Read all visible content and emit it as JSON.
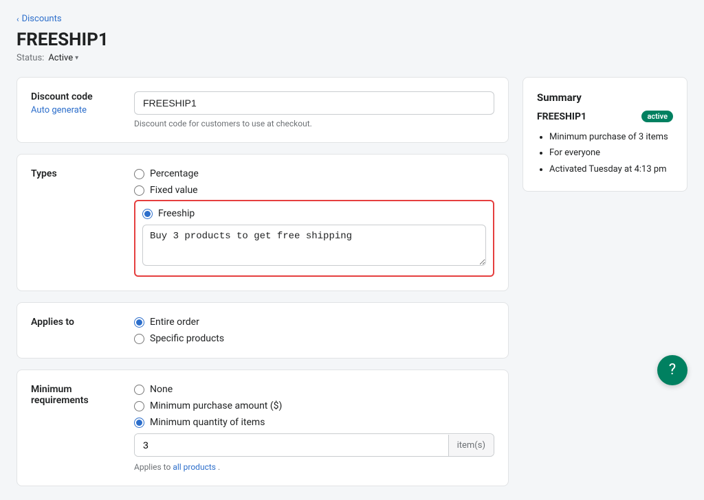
{
  "breadcrumb": {
    "label": "Discounts",
    "chevron": "‹"
  },
  "page": {
    "title": "FREESHIP1",
    "status_label": "Status:",
    "status_value": "Active",
    "status_chevron": "▾"
  },
  "discount_code_section": {
    "label": "Discount code",
    "auto_generate": "Auto generate",
    "input_value": "FREESHIP1",
    "hint": "Discount code for customers to use at checkout."
  },
  "types_section": {
    "label": "Types",
    "options": [
      {
        "id": "percentage",
        "label": "Percentage",
        "checked": false
      },
      {
        "id": "fixed",
        "label": "Fixed value",
        "checked": false
      },
      {
        "id": "freeship",
        "label": "Freeship",
        "checked": true
      }
    ],
    "freeship_textarea": "Buy 3 products to get free shipping"
  },
  "applies_to_section": {
    "label": "Applies to",
    "options": [
      {
        "id": "entire",
        "label": "Entire order",
        "checked": true
      },
      {
        "id": "specific",
        "label": "Specific products",
        "checked": false
      }
    ]
  },
  "min_requirements_section": {
    "label": "Minimum",
    "label2": "requirements",
    "options": [
      {
        "id": "none",
        "label": "None",
        "checked": false
      },
      {
        "id": "amount",
        "label": "Minimum purchase amount ($)",
        "checked": false
      },
      {
        "id": "quantity",
        "label": "Minimum quantity of items",
        "checked": true
      }
    ],
    "quantity_value": "3",
    "quantity_suffix": "item(s)",
    "applies_hint": "Applies to",
    "applies_hint_link": "all products",
    "applies_hint_end": "."
  },
  "summary": {
    "title": "Summary",
    "code": "FREESHIP1",
    "badge": "active",
    "items": [
      "Minimum purchase of 3 items",
      "For everyone",
      "Activated Tuesday at 4:13 pm"
    ]
  },
  "fab": {
    "icon": "?"
  }
}
